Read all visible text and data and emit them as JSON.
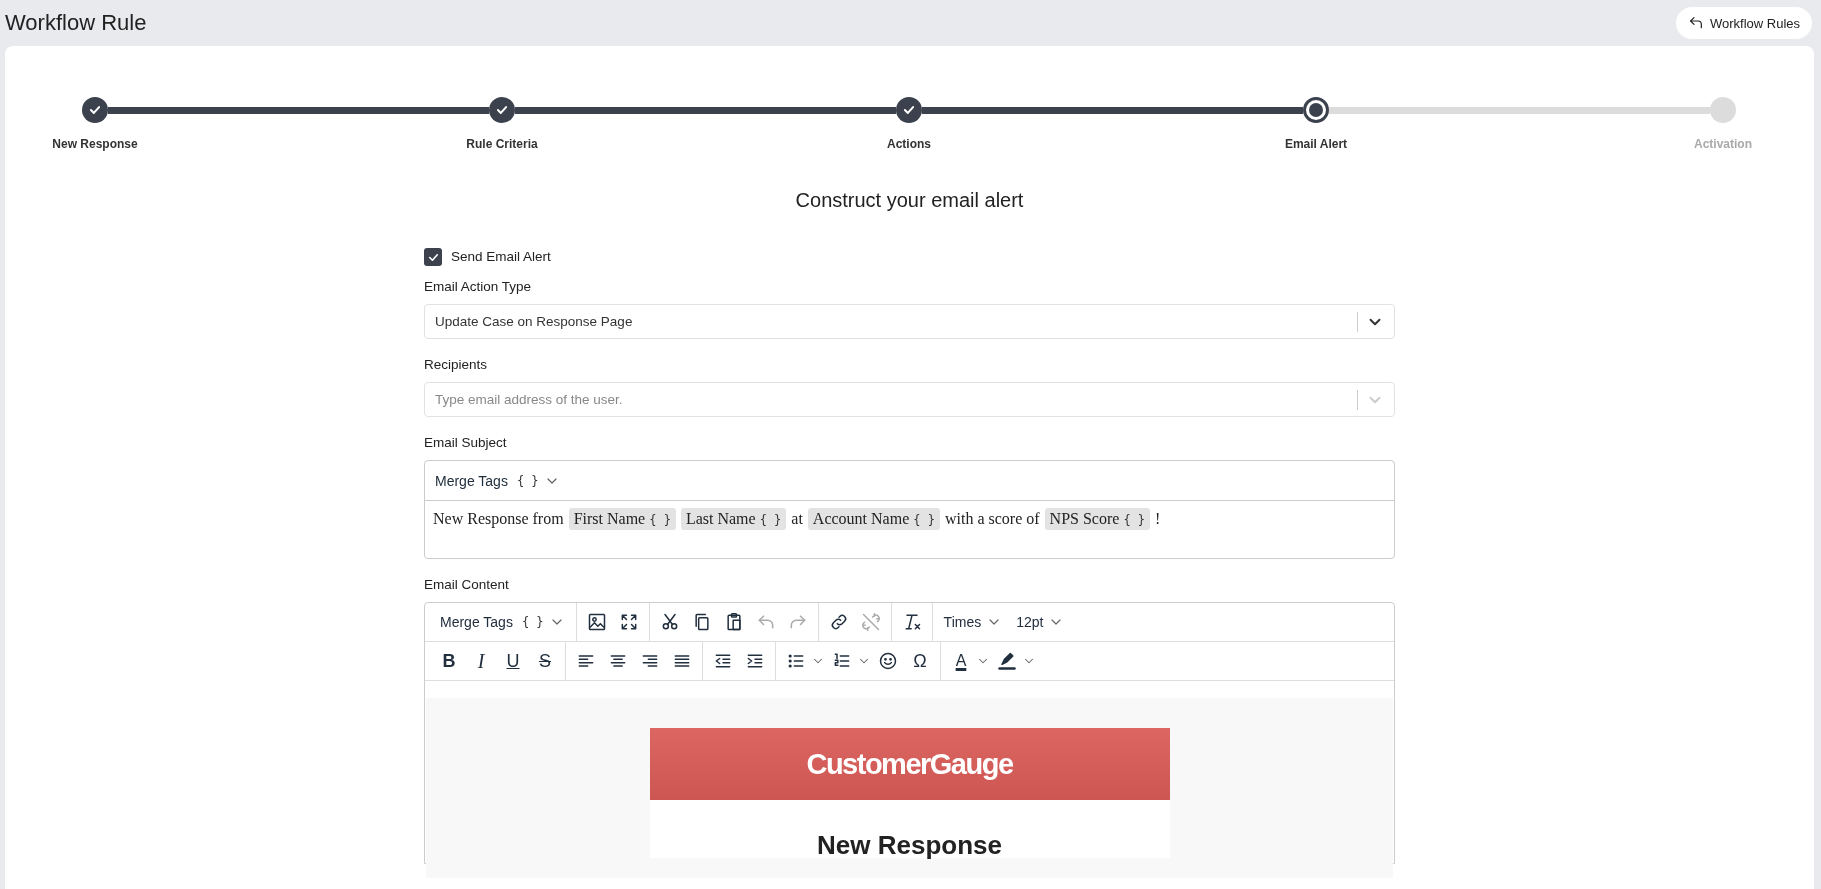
{
  "header": {
    "title": "Workflow Rule",
    "back_button": "Workflow Rules"
  },
  "steps": [
    {
      "label": "New Response",
      "completed": true,
      "current": false
    },
    {
      "label": "Rule Criteria",
      "completed": true,
      "current": false
    },
    {
      "label": "Actions",
      "completed": true,
      "current": false
    },
    {
      "label": "Email Alert",
      "completed": false,
      "current": true
    },
    {
      "label": "Activation",
      "completed": false,
      "current": false
    }
  ],
  "form": {
    "heading": "Construct your email alert",
    "send_email_alert": {
      "label": "Send Email Alert",
      "checked": true
    },
    "email_action_type": {
      "label": "Email Action Type",
      "value": "Update Case on Response Page"
    },
    "recipients": {
      "label": "Recipients",
      "placeholder": "Type email address of the user."
    },
    "email_subject": {
      "label": "Email Subject",
      "merge_tags": {
        "label": "Merge Tags",
        "braces": "{ }"
      },
      "content": [
        {
          "kind": "text",
          "text": "New Response from"
        },
        {
          "kind": "tag",
          "text": "First Name",
          "braces": "{ }"
        },
        {
          "kind": "tag",
          "text": "Last Name",
          "braces": "{ }"
        },
        {
          "kind": "text",
          "text": "at"
        },
        {
          "kind": "tag",
          "text": "Account Name",
          "braces": "{ }"
        },
        {
          "kind": "text",
          "text": "with a score of"
        },
        {
          "kind": "tag",
          "text": "NPS Score",
          "braces": "{ }"
        },
        {
          "kind": "text",
          "text": "!"
        }
      ]
    },
    "email_content": {
      "label": "Email Content",
      "toolbar": [
        [
          [
            {
              "kind": "merge-tags",
              "label": "Merge Tags",
              "braces": "{ }"
            }
          ],
          [
            {
              "kind": "image",
              "disabled": false
            },
            {
              "kind": "fullscreen",
              "disabled": false
            }
          ],
          [
            {
              "kind": "cut",
              "disabled": false
            },
            {
              "kind": "copy",
              "disabled": false
            },
            {
              "kind": "paste",
              "disabled": false
            },
            {
              "kind": "undo",
              "disabled": true
            },
            {
              "kind": "redo",
              "disabled": true
            }
          ],
          [
            {
              "kind": "link",
              "disabled": false
            },
            {
              "kind": "unlink",
              "disabled": true
            }
          ],
          [
            {
              "kind": "clear-format",
              "disabled": false
            }
          ],
          [
            {
              "kind": "dropdown",
              "text": "Times"
            },
            {
              "kind": "dropdown",
              "text": "12pt"
            }
          ]
        ],
        [
          [
            {
              "kind": "bold",
              "glyph": "B"
            },
            {
              "kind": "italic",
              "glyph": "I"
            },
            {
              "kind": "underline",
              "glyph": "U"
            },
            {
              "kind": "strikethrough",
              "glyph": "S"
            }
          ],
          [
            {
              "kind": "align-left",
              "disabled": false
            },
            {
              "kind": "align-center",
              "disabled": false
            },
            {
              "kind": "align-right",
              "disabled": false
            },
            {
              "kind": "justify",
              "disabled": false
            }
          ],
          [
            {
              "kind": "outdent",
              "disabled": false
            },
            {
              "kind": "indent",
              "disabled": false
            }
          ],
          [
            {
              "kind": "bullet-list",
              "disabled": false
            },
            {
              "kind": "number-list",
              "disabled": false
            },
            {
              "kind": "emoji",
              "disabled": false
            },
            {
              "kind": "special-char",
              "glyph": "Ω"
            }
          ],
          [
            {
              "kind": "text-color",
              "glyph": "A"
            },
            {
              "kind": "highlight",
              "disabled": false
            }
          ]
        ]
      ],
      "preview": {
        "logo": "CustomerGauge",
        "title": "New Response"
      }
    }
  }
}
